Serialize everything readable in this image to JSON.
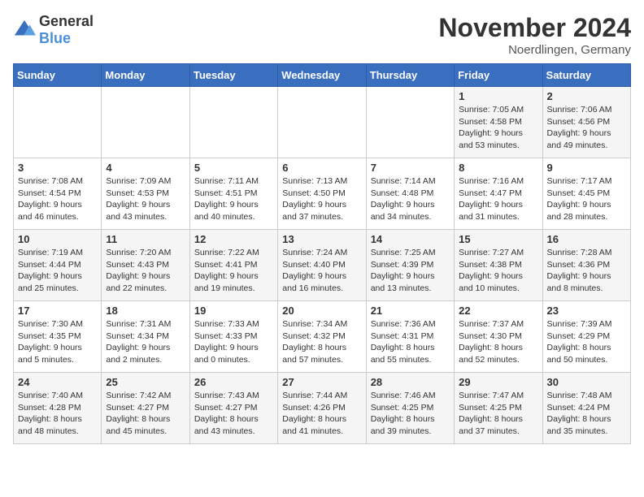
{
  "logo": {
    "text_general": "General",
    "text_blue": "Blue"
  },
  "header": {
    "month_year": "November 2024",
    "location": "Noerdlingen, Germany"
  },
  "days_of_week": [
    "Sunday",
    "Monday",
    "Tuesday",
    "Wednesday",
    "Thursday",
    "Friday",
    "Saturday"
  ],
  "weeks": [
    [
      {
        "day": "",
        "info": ""
      },
      {
        "day": "",
        "info": ""
      },
      {
        "day": "",
        "info": ""
      },
      {
        "day": "",
        "info": ""
      },
      {
        "day": "",
        "info": ""
      },
      {
        "day": "1",
        "info": "Sunrise: 7:05 AM\nSunset: 4:58 PM\nDaylight: 9 hours and 53 minutes."
      },
      {
        "day": "2",
        "info": "Sunrise: 7:06 AM\nSunset: 4:56 PM\nDaylight: 9 hours and 49 minutes."
      }
    ],
    [
      {
        "day": "3",
        "info": "Sunrise: 7:08 AM\nSunset: 4:54 PM\nDaylight: 9 hours and 46 minutes."
      },
      {
        "day": "4",
        "info": "Sunrise: 7:09 AM\nSunset: 4:53 PM\nDaylight: 9 hours and 43 minutes."
      },
      {
        "day": "5",
        "info": "Sunrise: 7:11 AM\nSunset: 4:51 PM\nDaylight: 9 hours and 40 minutes."
      },
      {
        "day": "6",
        "info": "Sunrise: 7:13 AM\nSunset: 4:50 PM\nDaylight: 9 hours and 37 minutes."
      },
      {
        "day": "7",
        "info": "Sunrise: 7:14 AM\nSunset: 4:48 PM\nDaylight: 9 hours and 34 minutes."
      },
      {
        "day": "8",
        "info": "Sunrise: 7:16 AM\nSunset: 4:47 PM\nDaylight: 9 hours and 31 minutes."
      },
      {
        "day": "9",
        "info": "Sunrise: 7:17 AM\nSunset: 4:45 PM\nDaylight: 9 hours and 28 minutes."
      }
    ],
    [
      {
        "day": "10",
        "info": "Sunrise: 7:19 AM\nSunset: 4:44 PM\nDaylight: 9 hours and 25 minutes."
      },
      {
        "day": "11",
        "info": "Sunrise: 7:20 AM\nSunset: 4:43 PM\nDaylight: 9 hours and 22 minutes."
      },
      {
        "day": "12",
        "info": "Sunrise: 7:22 AM\nSunset: 4:41 PM\nDaylight: 9 hours and 19 minutes."
      },
      {
        "day": "13",
        "info": "Sunrise: 7:24 AM\nSunset: 4:40 PM\nDaylight: 9 hours and 16 minutes."
      },
      {
        "day": "14",
        "info": "Sunrise: 7:25 AM\nSunset: 4:39 PM\nDaylight: 9 hours and 13 minutes."
      },
      {
        "day": "15",
        "info": "Sunrise: 7:27 AM\nSunset: 4:38 PM\nDaylight: 9 hours and 10 minutes."
      },
      {
        "day": "16",
        "info": "Sunrise: 7:28 AM\nSunset: 4:36 PM\nDaylight: 9 hours and 8 minutes."
      }
    ],
    [
      {
        "day": "17",
        "info": "Sunrise: 7:30 AM\nSunset: 4:35 PM\nDaylight: 9 hours and 5 minutes."
      },
      {
        "day": "18",
        "info": "Sunrise: 7:31 AM\nSunset: 4:34 PM\nDaylight: 9 hours and 2 minutes."
      },
      {
        "day": "19",
        "info": "Sunrise: 7:33 AM\nSunset: 4:33 PM\nDaylight: 9 hours and 0 minutes."
      },
      {
        "day": "20",
        "info": "Sunrise: 7:34 AM\nSunset: 4:32 PM\nDaylight: 8 hours and 57 minutes."
      },
      {
        "day": "21",
        "info": "Sunrise: 7:36 AM\nSunset: 4:31 PM\nDaylight: 8 hours and 55 minutes."
      },
      {
        "day": "22",
        "info": "Sunrise: 7:37 AM\nSunset: 4:30 PM\nDaylight: 8 hours and 52 minutes."
      },
      {
        "day": "23",
        "info": "Sunrise: 7:39 AM\nSunset: 4:29 PM\nDaylight: 8 hours and 50 minutes."
      }
    ],
    [
      {
        "day": "24",
        "info": "Sunrise: 7:40 AM\nSunset: 4:28 PM\nDaylight: 8 hours and 48 minutes."
      },
      {
        "day": "25",
        "info": "Sunrise: 7:42 AM\nSunset: 4:27 PM\nDaylight: 8 hours and 45 minutes."
      },
      {
        "day": "26",
        "info": "Sunrise: 7:43 AM\nSunset: 4:27 PM\nDaylight: 8 hours and 43 minutes."
      },
      {
        "day": "27",
        "info": "Sunrise: 7:44 AM\nSunset: 4:26 PM\nDaylight: 8 hours and 41 minutes."
      },
      {
        "day": "28",
        "info": "Sunrise: 7:46 AM\nSunset: 4:25 PM\nDaylight: 8 hours and 39 minutes."
      },
      {
        "day": "29",
        "info": "Sunrise: 7:47 AM\nSunset: 4:25 PM\nDaylight: 8 hours and 37 minutes."
      },
      {
        "day": "30",
        "info": "Sunrise: 7:48 AM\nSunset: 4:24 PM\nDaylight: 8 hours and 35 minutes."
      }
    ]
  ]
}
